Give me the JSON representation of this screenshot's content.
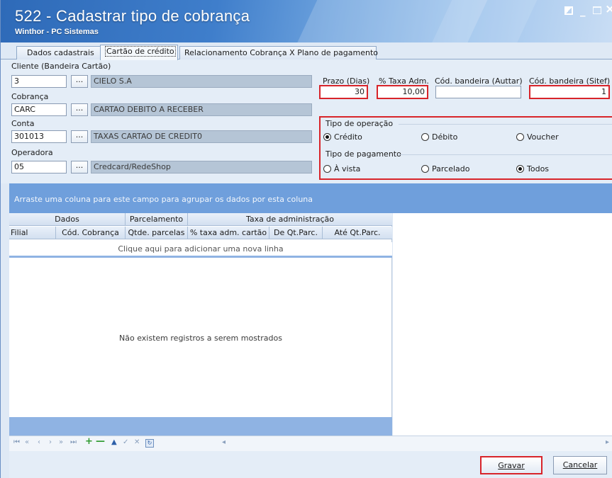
{
  "window": {
    "title": "522 - Cadastrar tipo de cobrança",
    "subtitle": "Winthor - PC Sistemas"
  },
  "tabs": [
    {
      "label": "Dados cadastrais"
    },
    {
      "label": "Cartão de crédito",
      "selected": true
    },
    {
      "label": "Relacionamento Cobrança X Plano de pagamento"
    }
  ],
  "form": {
    "cliente": {
      "label": "Cliente (Bandeira Cartão)",
      "code": "3",
      "name": "CIELO S.A"
    },
    "cobranca": {
      "label": "Cobrança",
      "code": "CARC",
      "name": "CARTAO DEBITO A RECEBER"
    },
    "conta": {
      "label": "Conta",
      "code": "301013",
      "name": "TAXAS CARTAO DE CREDIT0"
    },
    "operadora": {
      "label": "Operadora",
      "code": "05",
      "name": "Credcard/RedeShop"
    },
    "lookup_button": "...",
    "prazo": {
      "label": "Prazo (Dias)",
      "value": "30"
    },
    "taxa": {
      "label": "% Taxa Adm.",
      "value": "10,00"
    },
    "cod_auttar": {
      "label": "Cód. bandeira (Auttar)",
      "value": ""
    },
    "cod_sitef": {
      "label": "Cód. bandeira (Sitef)",
      "value": "1"
    },
    "tipo_operacao": {
      "label": "Tipo de operação",
      "options": [
        "Crédito",
        "Débito",
        "Voucher"
      ],
      "selected": "Crédito"
    },
    "tipo_pagamento": {
      "label": "Tipo de pagamento",
      "options": [
        "À vista",
        "Parcelado",
        "Todos"
      ],
      "selected": "Todos"
    }
  },
  "grid": {
    "group_hint": "Arraste uma coluna para este campo para agrupar os dados por esta coluna",
    "bands": [
      "Dados",
      "Parcelamento",
      "Taxa de administração"
    ],
    "columns": [
      "Filial",
      "Cód. Cobrança",
      "Qtde. parcelas",
      "% taxa adm. cartão",
      "De Qt.Parc.",
      "Até Qt.Parc."
    ],
    "new_row_hint": "Clique aqui para adicionar uma nova linha",
    "empty_text": "Não existem registros a serem mostrados"
  },
  "navigator": {
    "first": "⏮",
    "prev_page": "«",
    "prev": "‹",
    "next": "›",
    "next_page": "»",
    "last": "⏭",
    "add": "+",
    "remove": "—",
    "edit": "▲",
    "post": "✓",
    "cancel": "✕",
    "refresh": "↻",
    "scroll_left": "◂",
    "scroll_right": "▸"
  },
  "buttons": {
    "gravar": "Gravar",
    "cancelar": "Cancelar"
  },
  "colors": {
    "highlight": "#d8242a",
    "group_bar": "#6f9fdc",
    "readonly_field": "#b5c5d6"
  }
}
